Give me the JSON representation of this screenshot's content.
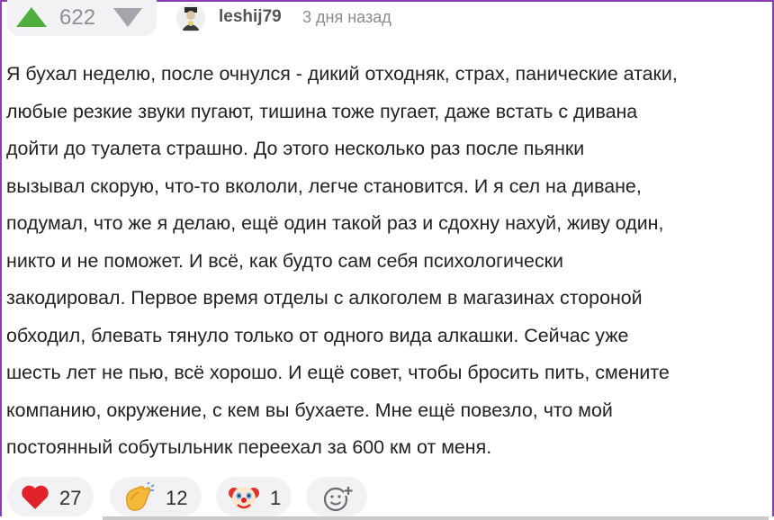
{
  "vote": {
    "count": "622",
    "up_color": "#4fae3d",
    "down_color": "#a4a4aa"
  },
  "author": {
    "username": "leshij79",
    "timestamp": "3 дня назад"
  },
  "comment": {
    "lines": [
      "Я бухал неделю, после очнулся - дикий отходняк, страх, панические атаки,",
      "любые резкие звуки пугают, тишина тоже пугает, даже встать с дивана",
      "дойти до туалета страшно. До этого несколько раз после пьянки",
      "вызывал скорую, что-то вкололи, легче становится. И я сел на диване,",
      "подумал, что же я делаю, ещё один такой раз и сдохну нахуй, живу один,",
      "никто и не поможет. И всё, как будто сам себя психологически",
      "закодировал. Первое время отделы с алкоголем в магазинах стороной",
      "обходил, блевать тянуло только от одного вида алкашки. Сейчас уже",
      "шесть лет не пью, всё хорошо. И ещё совет, чтобы бросить пить, смените",
      "компанию, окружение, с кем вы бухаете. Мне ещё повезло, что мой",
      "постоянный собутыльник переехал за 600 км от меня."
    ]
  },
  "reactions": [
    {
      "icon": "heart-icon",
      "count": "27"
    },
    {
      "icon": "clapping-hand-icon",
      "count": "12"
    },
    {
      "icon": "clown-face-icon",
      "count": "1"
    },
    {
      "icon": "add-reaction-icon",
      "count": ""
    }
  ],
  "accent_border": "#8a3fb0"
}
